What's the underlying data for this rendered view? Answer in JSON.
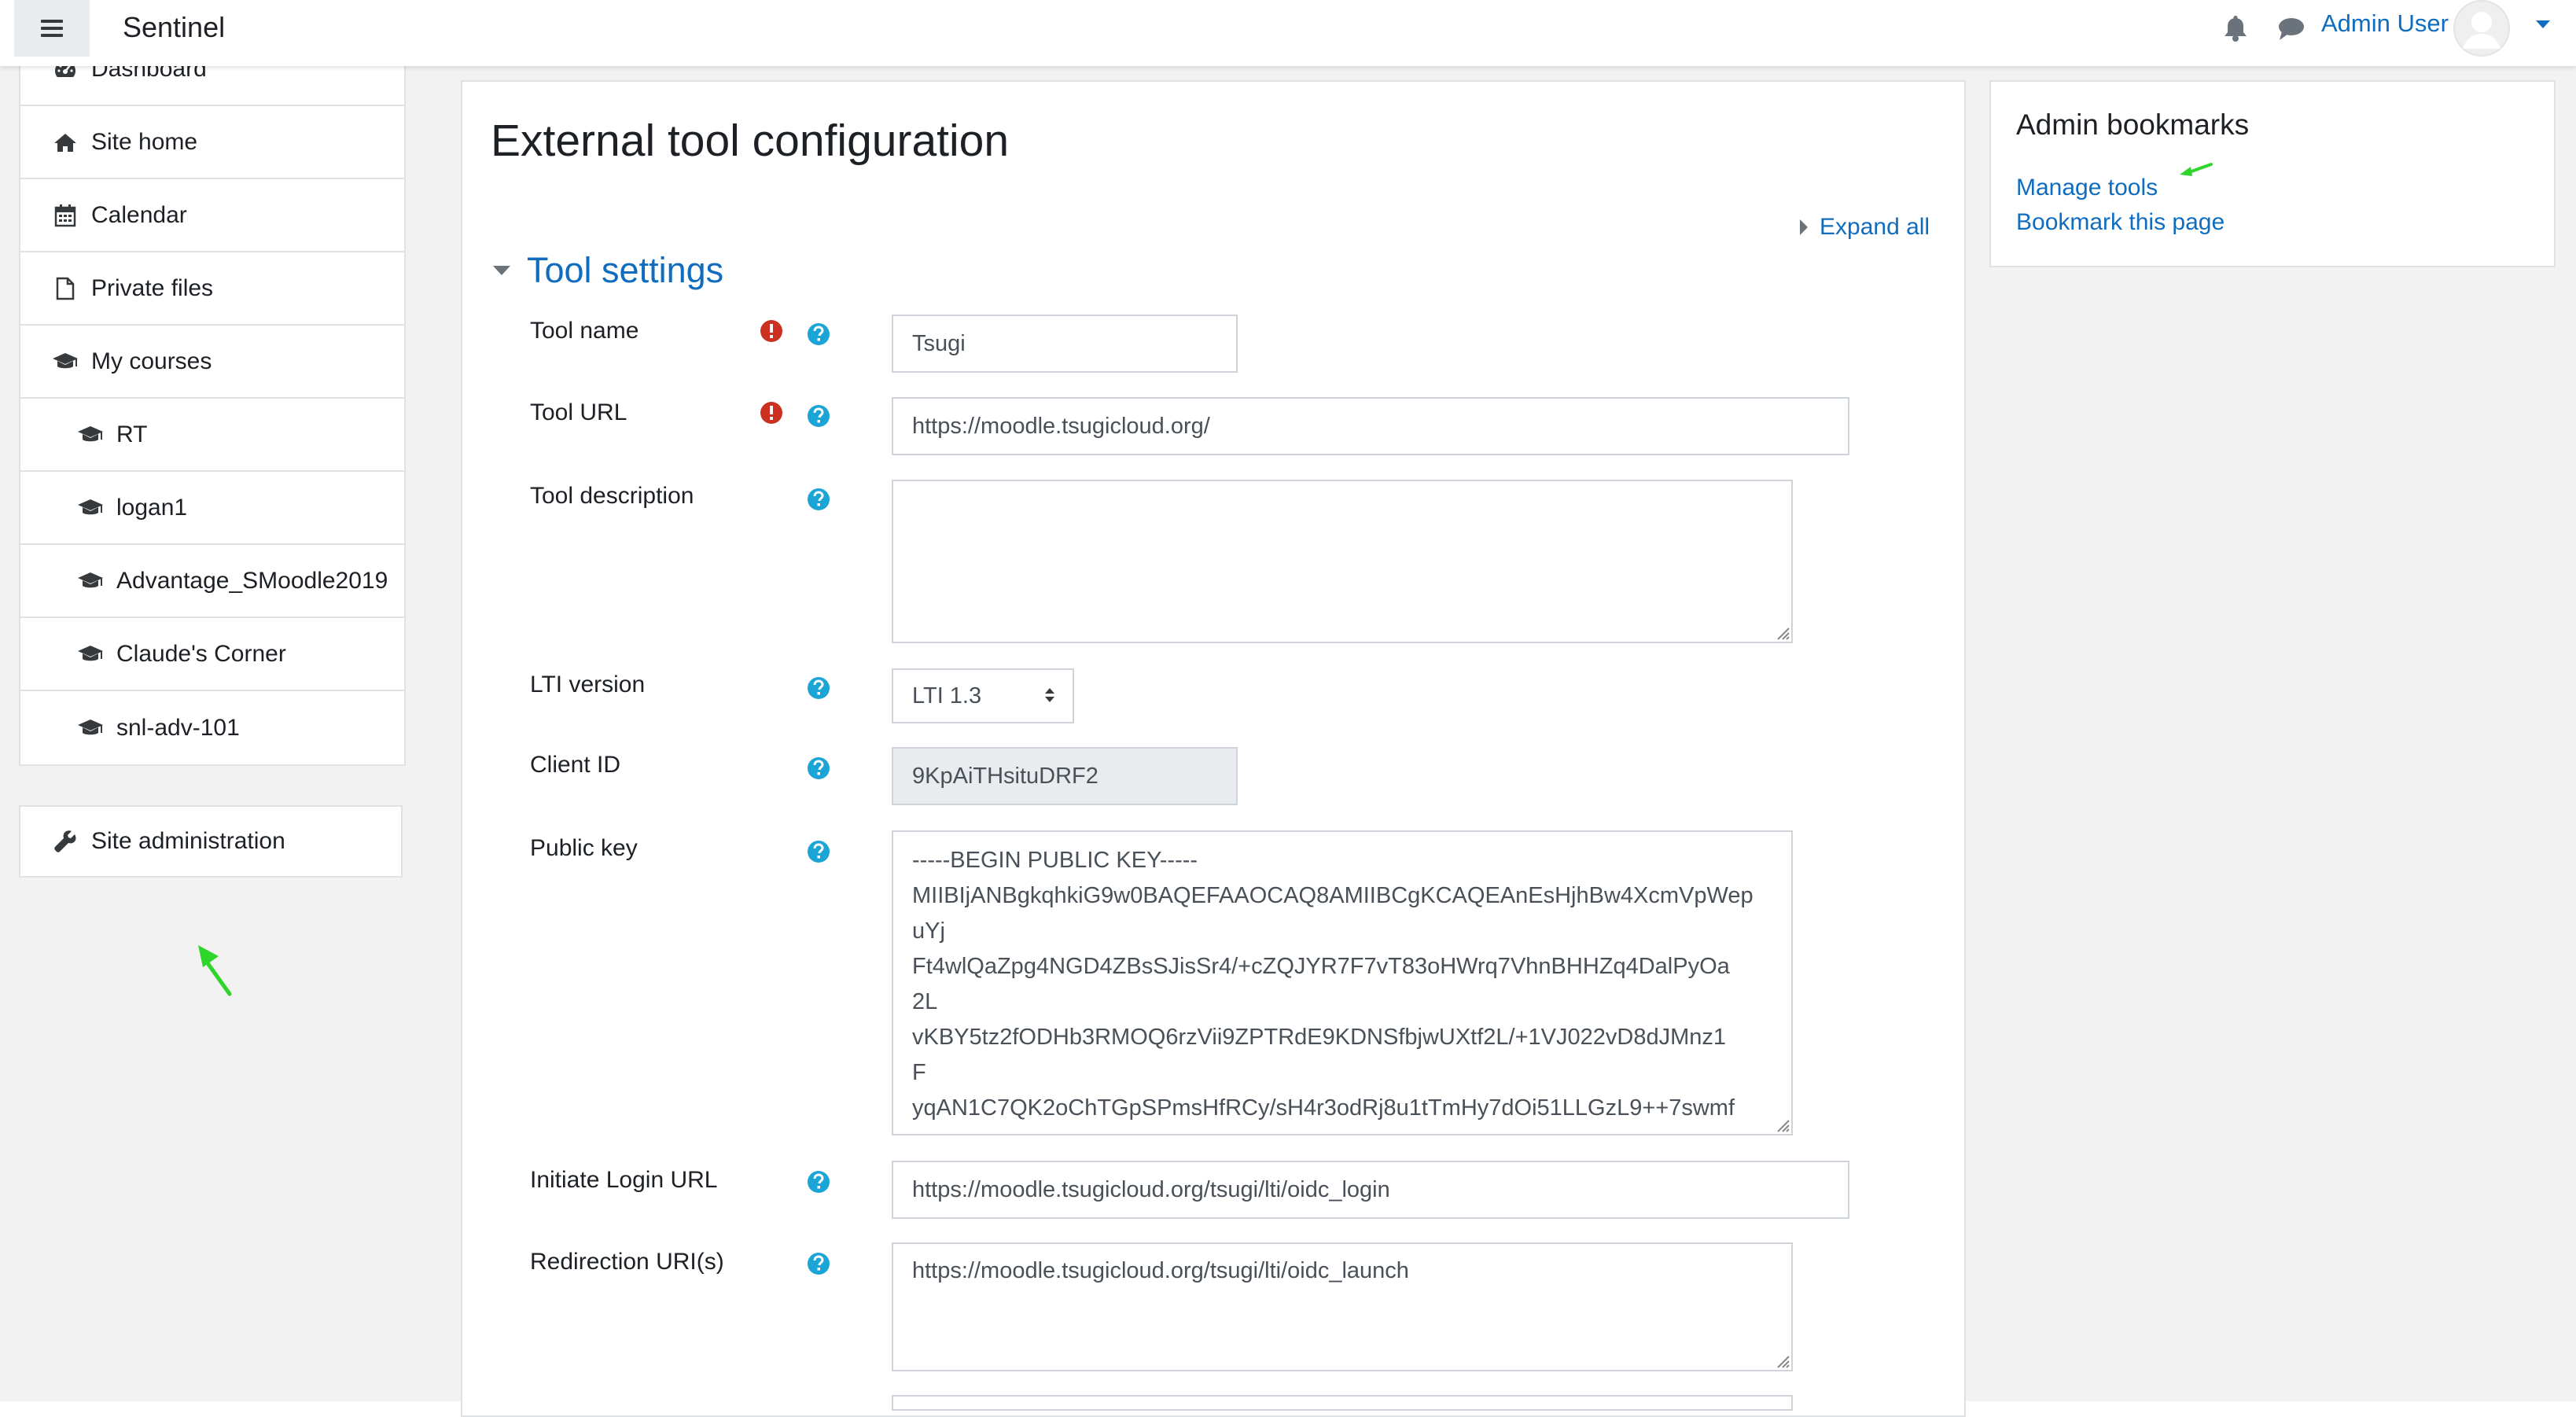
{
  "navbar": {
    "site_name": "Sentinel",
    "user_name": "Admin User",
    "menu_icon": "hamburger-menu-icon",
    "notification_icon": "bell-icon",
    "messages_icon": "chat-bubble-icon"
  },
  "nav": {
    "items": [
      {
        "label": "Dashboard",
        "icon": "dashboard-icon"
      },
      {
        "label": "Site home",
        "icon": "home-icon"
      },
      {
        "label": "Calendar",
        "icon": "calendar-icon"
      },
      {
        "label": "Private files",
        "icon": "file-icon"
      },
      {
        "label": "My courses",
        "icon": "graduation-cap-icon"
      }
    ],
    "courses": [
      "RT",
      "logan1",
      "Advantage_SMoodle2019",
      "Claude's Corner",
      "snl-adv-101"
    ],
    "site_admin": "Site administration"
  },
  "main": {
    "page_title": "External tool configuration",
    "expand_all": "Expand all",
    "section_title": "Tool settings",
    "fields": {
      "tool_name": {
        "label": "Tool name",
        "value": "Tsugi"
      },
      "tool_url": {
        "label": "Tool URL",
        "value": "https://moodle.tsugicloud.org/"
      },
      "tool_description": {
        "label": "Tool description",
        "value": ""
      },
      "lti_version": {
        "label": "LTI version",
        "value": "LTI 1.3"
      },
      "client_id": {
        "label": "Client ID",
        "value": "9KpAiTHsituDRF2"
      },
      "public_key": {
        "label": "Public key",
        "value": "-----BEGIN PUBLIC KEY-----\nMIIBIjANBgkqhkiG9w0BAQEFAAOCAQ8AMIIBCgKCAQEAnEsHjhBw4XcmVpWep\nuYj\nFt4wlQaZpg4NGD4ZBsSJisSr4/+cZQJYR7F7vT83oHWrq7VhnBHHZq4DalPyOa\n2L\nvKBY5tz2fODHb3RMOQ6rzVii9ZPTRdE9KDNSfbjwUXtf2L/+1VJ022vD8dJMnz1\nF\nyqAN1C7QK2oChTGpSPmsHfRCy/sH4r3odRj8u1tTmHy7dOi51LLGzL9++7swmf"
      },
      "initiate_login_url": {
        "label": "Initiate Login URL",
        "value": "https://moodle.tsugicloud.org/tsugi/lti/oidc_login"
      },
      "redirection_uris": {
        "label": "Redirection URI(s)",
        "value": "https://moodle.tsugicloud.org/tsugi/lti/oidc_launch"
      }
    }
  },
  "bookmarks": {
    "title": "Admin bookmarks",
    "links": [
      "Manage tools",
      "Bookmark this page"
    ]
  },
  "colors": {
    "link": "#0f6cbf",
    "required": "#ca3120",
    "help": "#1ba4d6",
    "annotation_arrow": "#2ed52a"
  }
}
